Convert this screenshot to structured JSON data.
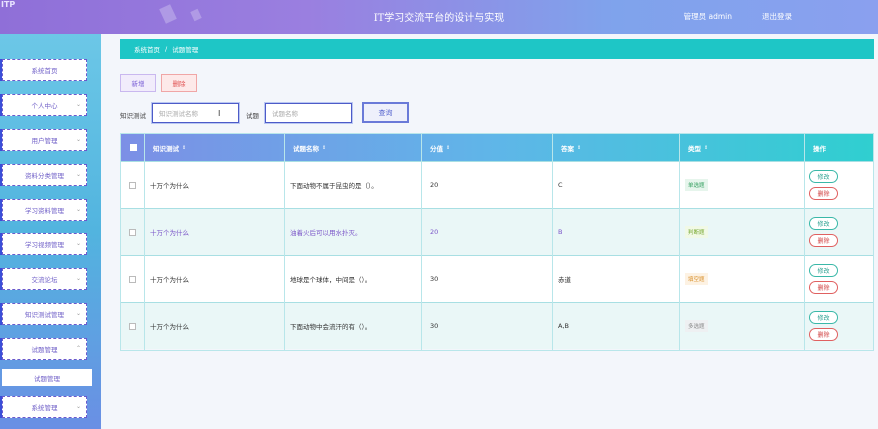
{
  "header": {
    "logo": "ITP",
    "title": "IT学习交流平台的设计与实现",
    "user": "管理员 admin",
    "logout": "退出登录"
  },
  "sidebar": {
    "items": [
      {
        "label": "系统首页",
        "chevron": false
      },
      {
        "label": "个人中心",
        "chevron": true
      },
      {
        "label": "用户管理",
        "chevron": true
      },
      {
        "label": "资料分类管理",
        "chevron": true
      },
      {
        "label": "学习资料管理",
        "chevron": true
      },
      {
        "label": "学习视频管理",
        "chevron": true
      },
      {
        "label": "交流论坛",
        "chevron": true
      },
      {
        "label": "知识测试管理",
        "chevron": true
      },
      {
        "label": "试题管理",
        "chevron": true,
        "expanded": true
      },
      {
        "label": "系统管理",
        "chevron": true
      }
    ],
    "sub_item": "试题管理"
  },
  "breadcrumb": {
    "home": "系统首页",
    "separator": "/",
    "current": "试题管理"
  },
  "toolbar": {
    "add_label": "新增",
    "delete_label": "删除"
  },
  "search": {
    "field1_label": "知识测试",
    "field1_placeholder": "知识测试名称",
    "field2_label": "试题",
    "field2_placeholder": "试题名称",
    "query_label": "查询"
  },
  "table": {
    "columns": [
      "知识测试",
      "试题名称",
      "分值",
      "答案",
      "类型",
      "操作"
    ],
    "rows": [
      {
        "test": "十万个为什么",
        "question": "下面动物不属于昆虫的是（）。",
        "score": "20",
        "answer": "C",
        "type": "单选题",
        "type_class": "b-single"
      },
      {
        "test": "十万个为什么",
        "question": "油着火后可以用水扑灭。",
        "score": "20",
        "answer": "B",
        "type": "判断题",
        "type_class": "b-judge"
      },
      {
        "test": "十万个为什么",
        "question": "地球是个球体，中间是（）。",
        "score": "30",
        "answer": "赤道",
        "type": "填空题",
        "type_class": "b-fill"
      },
      {
        "test": "十万个为什么",
        "question": "下面动物中会流汗的有（）。",
        "score": "30",
        "answer": "A,B",
        "type": "多选题",
        "type_class": "b-multi"
      }
    ],
    "edit_label": "修改",
    "delete_label": "删除"
  },
  "colors": {
    "header_start": "#8f6fd8",
    "header_end": "#8aa0ef",
    "breadcrumb": "#1ec6c6",
    "accent_purple": "#7a55c8"
  }
}
